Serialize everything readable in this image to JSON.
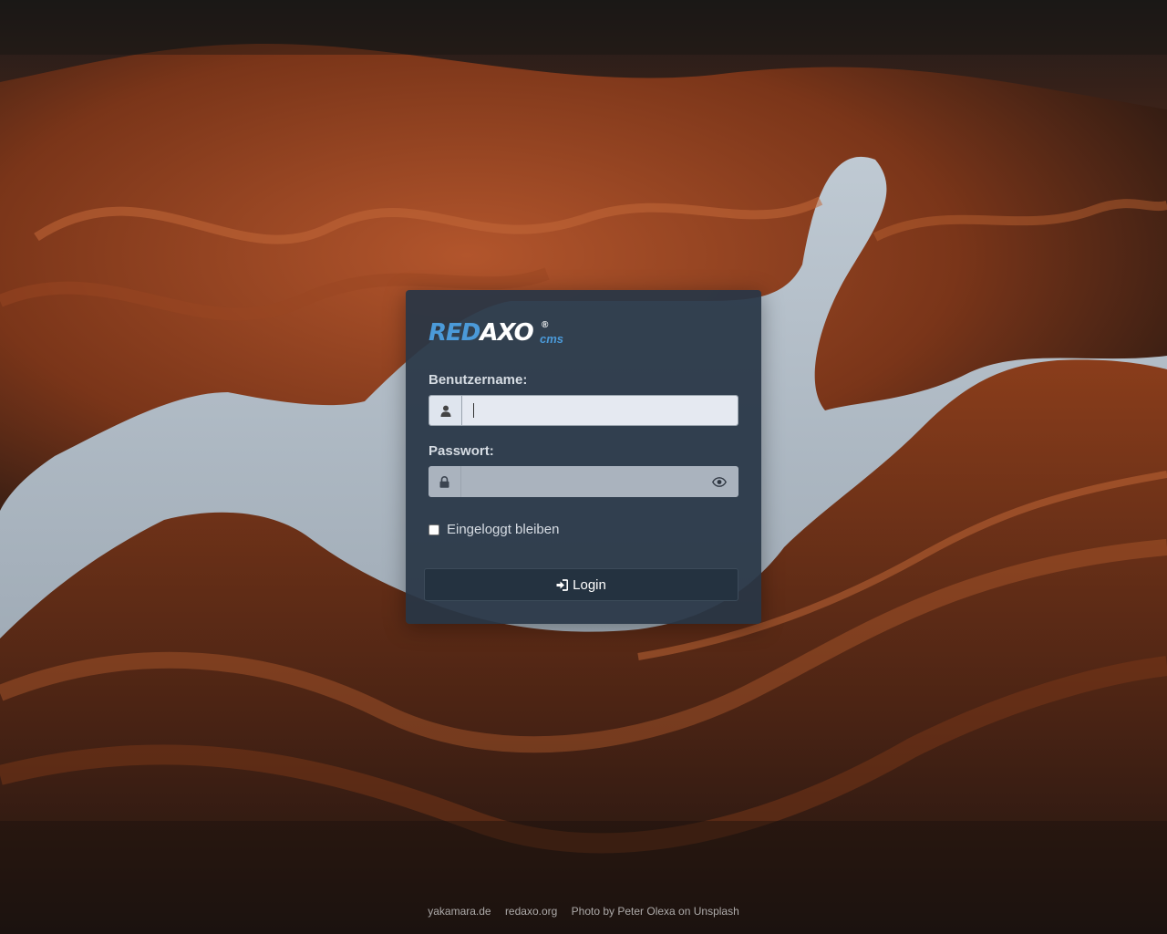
{
  "brand": {
    "logo_red": "RED",
    "logo_axo": "AXO",
    "logo_reg": "®",
    "logo_cms": "cms"
  },
  "form": {
    "username_label": "Benutzername:",
    "username_value": "",
    "username_icon": "user-icon",
    "password_label": "Passwort:",
    "password_value": "",
    "password_icon": "lock-icon",
    "password_toggle_icon": "eye-icon",
    "remember_label": "Eingeloggt bleiben",
    "remember_checked": false,
    "login_label": "Login",
    "login_icon": "sign-in-icon"
  },
  "footer": {
    "links": [
      "yakamara.de",
      "redaxo.org",
      "Photo by Peter Olexa on Unsplash"
    ]
  },
  "colors": {
    "accent": "#4b9ad9",
    "panel": "#283646",
    "button": "#243240"
  }
}
